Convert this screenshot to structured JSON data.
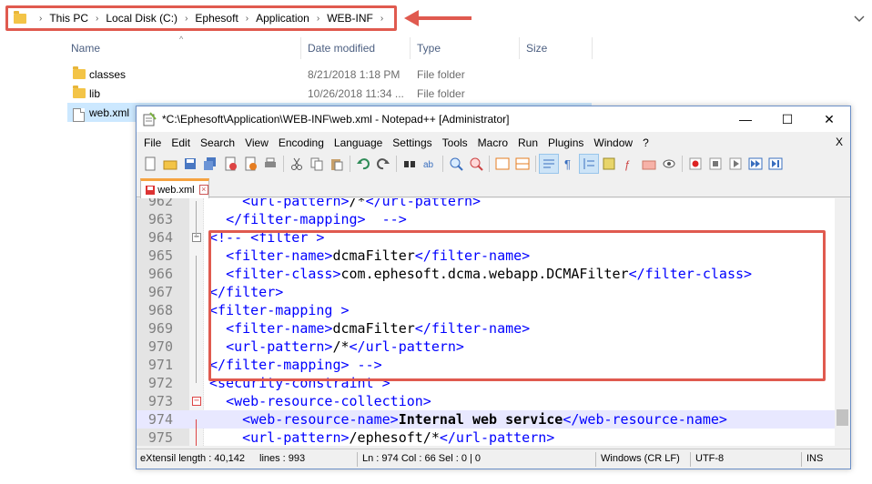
{
  "explorer": {
    "breadcrumb": [
      "This PC",
      "Local Disk (C:)",
      "Ephesoft",
      "Application",
      "WEB-INF"
    ],
    "columns": {
      "name": "Name",
      "date": "Date modified",
      "type": "Type",
      "size": "Size"
    },
    "files": [
      {
        "name": "classes",
        "date": "8/21/2018 1:18 PM",
        "type": "File folder",
        "icon": "folder-icon"
      },
      {
        "name": "lib",
        "date": "10/26/2018 11:34 ...",
        "type": "File folder",
        "icon": "folder-icon"
      },
      {
        "name": "web.xml",
        "date": "",
        "type": "",
        "icon": "xml-file-icon"
      }
    ]
  },
  "npp": {
    "title": "*C:\\Ephesoft\\Application\\WEB-INF\\web.xml - Notepad++ [Administrator]",
    "window_buttons": {
      "minimize": "—",
      "maximize": "☐",
      "close": "✕"
    },
    "menu": [
      "File",
      "Edit",
      "Search",
      "View",
      "Encoding",
      "Language",
      "Settings",
      "Tools",
      "Macro",
      "Run",
      "Plugins",
      "Window",
      "?"
    ],
    "menu_close": "X",
    "tab_label": "web.xml",
    "lines": [
      {
        "n": "962",
        "parts": [
          [
            "    ",
            "txt"
          ],
          [
            "<url-pattern>",
            "tag"
          ],
          [
            "/*",
            "txt"
          ],
          [
            "</url-pattern>",
            "tag"
          ]
        ]
      },
      {
        "n": "963",
        "parts": [
          [
            "  ",
            "txt"
          ],
          [
            "</filter-mapping>",
            "tag"
          ],
          [
            "  -->",
            "tag"
          ]
        ]
      },
      {
        "n": "964",
        "parts": [
          [
            "<!-- <filter >",
            "tag"
          ]
        ]
      },
      {
        "n": "965",
        "parts": [
          [
            "  ",
            "txt"
          ],
          [
            "<filter-name>",
            "tag"
          ],
          [
            "dcmaFilter",
            "txt"
          ],
          [
            "</filter-name>",
            "tag"
          ]
        ]
      },
      {
        "n": "966",
        "parts": [
          [
            "  ",
            "txt"
          ],
          [
            "<filter-class>",
            "tag"
          ],
          [
            "com.ephesoft.dcma.webapp.DCMAFilter",
            "txt"
          ],
          [
            "</filter-class>",
            "tag"
          ]
        ]
      },
      {
        "n": "967",
        "parts": [
          [
            "</filter>",
            "tag"
          ]
        ]
      },
      {
        "n": "968",
        "parts": [
          [
            "<filter-mapping >",
            "tag"
          ]
        ]
      },
      {
        "n": "969",
        "parts": [
          [
            "  ",
            "txt"
          ],
          [
            "<filter-name>",
            "tag"
          ],
          [
            "dcmaFilter",
            "txt"
          ],
          [
            "</filter-name>",
            "tag"
          ]
        ]
      },
      {
        "n": "970",
        "parts": [
          [
            "  ",
            "txt"
          ],
          [
            "<url-pattern>",
            "tag"
          ],
          [
            "/*",
            "txt"
          ],
          [
            "</url-pattern>",
            "tag"
          ]
        ]
      },
      {
        "n": "971",
        "parts": [
          [
            "</filter-mapping>",
            "tag"
          ],
          [
            " -->",
            "tag"
          ]
        ]
      },
      {
        "n": "972",
        "parts": [
          [
            "<security-constraint >",
            "tag"
          ]
        ]
      },
      {
        "n": "973",
        "parts": [
          [
            "  ",
            "txt"
          ],
          [
            "<web-resource-collection>",
            "tag"
          ]
        ]
      },
      {
        "n": "974",
        "parts": [
          [
            "    ",
            "txt"
          ],
          [
            "<web-resource-name>",
            "tag"
          ],
          [
            "Internal web service",
            "bold"
          ],
          [
            "</web-resource-name>",
            "tag"
          ]
        ]
      },
      {
        "n": "975",
        "parts": [
          [
            "    ",
            "txt"
          ],
          [
            "<url-pattern>",
            "tag"
          ],
          [
            "/ephesoft/*",
            "txt"
          ],
          [
            "</url-pattern>",
            "tag"
          ]
        ]
      }
    ],
    "status": {
      "length": "eXtensil length : 40,142",
      "lines": "lines : 993",
      "pos": "Ln : 974   Col : 66   Sel : 0 | 0",
      "eol": "Windows (CR LF)",
      "encoding": "UTF-8",
      "mode": "INS"
    }
  },
  "colors": {
    "highlight": "#e05a4f",
    "tag": "#0000ff",
    "tab_accent": "#f6a341"
  }
}
